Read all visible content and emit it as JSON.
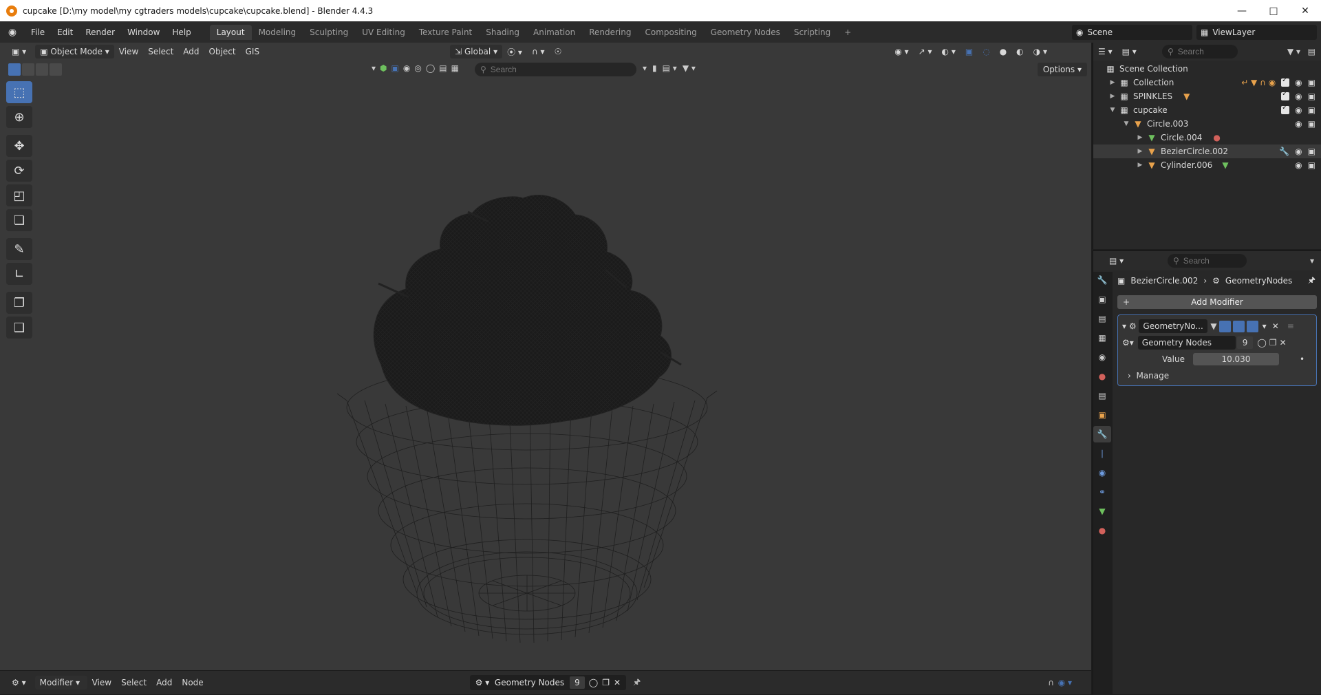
{
  "window": {
    "title": "cupcake [D:\\my model\\my cgtraders models\\cupcake\\cupcake.blend] - Blender 4.4.3",
    "minimize_icon": "minimize-icon",
    "maximize_icon": "maximize-icon",
    "close_icon": "close-icon"
  },
  "menu": [
    "File",
    "Edit",
    "Render",
    "Window",
    "Help"
  ],
  "workspaces": [
    "Layout",
    "Modeling",
    "Sculpting",
    "UV Editing",
    "Texture Paint",
    "Shading",
    "Animation",
    "Rendering",
    "Compositing",
    "Geometry Nodes",
    "Scripting"
  ],
  "active_workspace": "Layout",
  "scene": {
    "name": "Scene"
  },
  "view_layer": {
    "name": "ViewLayer"
  },
  "viewport": {
    "mode": "Object Mode",
    "menus": [
      "View",
      "Select",
      "Add",
      "Object",
      "GIS"
    ],
    "orientation": "Global",
    "search_placeholder": "Search",
    "options": "Options"
  },
  "toolbar": {
    "tools": [
      "select-box-icon",
      "cursor-icon",
      "move-icon",
      "rotate-icon",
      "scale-icon",
      "transform-icon",
      "annotate-icon",
      "measure-icon",
      "add-cube-icon",
      "add-primitive-icon"
    ]
  },
  "outliner": {
    "search_placeholder": "Search",
    "root": "Scene Collection",
    "rows": [
      {
        "name": "Collection",
        "level": 1,
        "expanded": false
      },
      {
        "name": "SPINKLES",
        "level": 1,
        "expanded": false
      },
      {
        "name": "cupcake",
        "level": 1,
        "expanded": true
      },
      {
        "name": "Circle.003",
        "level": 2,
        "expanded": true
      },
      {
        "name": "Circle.004",
        "level": 3,
        "expanded": false
      },
      {
        "name": "BezierCircle.002",
        "level": 3,
        "expanded": false
      },
      {
        "name": "Cylinder.006",
        "level": 3,
        "expanded": false
      }
    ]
  },
  "properties": {
    "search_placeholder": "Search",
    "breadcrumb_object": "BezierCircle.002",
    "breadcrumb_modifier": "GeometryNodes",
    "add_modifier": "Add Modifier",
    "modifier_name": "GeometryNo...",
    "node_group": "Geometry Nodes",
    "node_group_users": "9",
    "value_label": "Value",
    "value": "10.030",
    "manage": "Manage"
  },
  "node_editor": {
    "mode": "Modifier",
    "menus": [
      "View",
      "Select",
      "Add",
      "Node"
    ],
    "node_group": "Geometry Nodes",
    "users": "9"
  },
  "colors": {
    "accent": "#4772b3",
    "bg": "#393939"
  }
}
